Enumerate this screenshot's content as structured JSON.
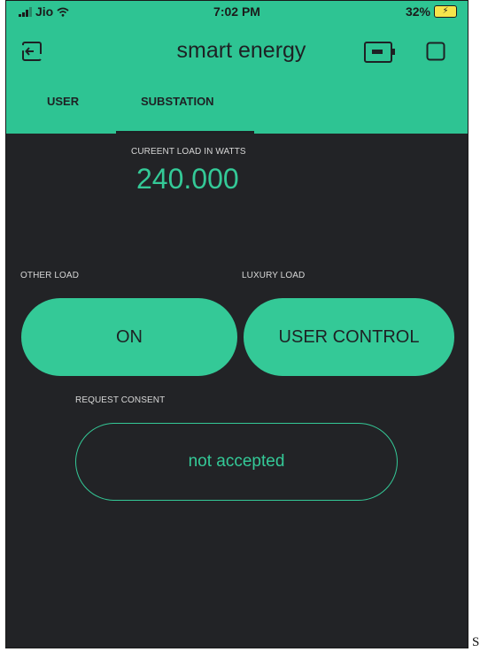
{
  "status_bar": {
    "carrier": "Jio",
    "time": "7:02 PM",
    "battery": "32%",
    "icons": [
      "signal-icon",
      "wifi-icon",
      "battery-charging-icon"
    ]
  },
  "app_bar": {
    "title": "smart energy",
    "icons": [
      "exit-icon",
      "device-icon",
      "square-icon"
    ],
    "color": "#2ec493"
  },
  "tabs": [
    {
      "label": "USER",
      "active": false
    },
    {
      "label": "SUBSTATION",
      "active": true
    }
  ],
  "current_load": {
    "label": "CUREENT LOAD IN WATTS",
    "value": "240.000"
  },
  "other_load": {
    "label": "OTHER LOAD",
    "button": "ON"
  },
  "luxury_load": {
    "label": "LUXURY LOAD",
    "button": "USER CONTROL"
  },
  "consent": {
    "label": "REQUEST CONSENT",
    "button": "not accepted"
  },
  "trailing_text": "S",
  "colors": {
    "accent": "#34c997",
    "background": "#222326"
  }
}
